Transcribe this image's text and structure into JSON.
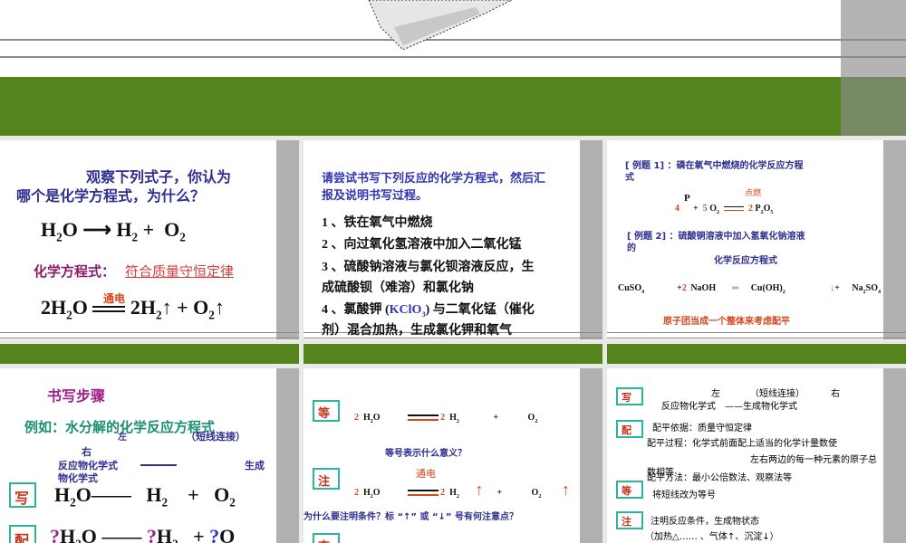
{
  "slide1": {
    "q1": "观察下列式子，你认为",
    "q2": "哪个是化学方程式，为什么？",
    "eq1": {
      "a": "H",
      "a2": "2",
      "a3": "O",
      "arrow": "⟶",
      "b": "H",
      "b2": "2",
      "plus": "+",
      "c": "O",
      "c2": "2"
    },
    "label": "化学方程式：",
    "law": "符合质量守恒定律",
    "cond": "通电",
    "eq2": {
      "a": "2H",
      "a2": "2",
      "a3": "O",
      "b": "2H",
      "b2": "2",
      "up": "↑",
      "plus": "+",
      "c": "O",
      "c2": "2"
    }
  },
  "slide2": {
    "title1": "请尝试书写下列反应的化学方程式，然后汇",
    "title2": "报及说明书写过程。",
    "items": [
      "1 、铁在氧气中燃烧",
      "2 、向过氧化氢溶液中加入二氧化锰",
      "3 、硫酸钠溶液与氯化钡溶液反应，生",
      "成硫酸钡（难溶）和氯化钠",
      "4 、氯酸钾 (",
      "KClO",
      "3",
      ") 与二氧化锰（催化",
      "剂）混合加热，生成氯化钾和氧气"
    ]
  },
  "slide3": {
    "ex1a": "[ 例题 1] ：磷在氧气中燃烧的化学反应方程",
    "ex1b": "式",
    "eqA": {
      "c1": "4",
      "p": "P",
      "plus": "+",
      "c2": "5",
      "o": "O",
      "o2": "2",
      "cond": "点燃",
      "c3": "2",
      "prod": "P",
      "p2": "2",
      "p3": "O",
      "p4": "5"
    },
    "ex2a": "[ 例题 2] ：硫酸铜溶液中加入氢氧化钠溶液",
    "ex2b": "的",
    "ex2c": "化学反应方程式",
    "eqB": {
      "a": "CuSO",
      "a2": "4",
      "plus": "+",
      "c": "2",
      "b": "NaOH",
      "eq": "═",
      "d": "Cu(OH)",
      "d2": "2",
      "down": "↓",
      "plus2": "+",
      "e": "Na",
      "e2": "2",
      "e3": "SO",
      "e4": "4"
    },
    "note": "原子团当成一个整体来考虑配平"
  },
  "slide4": {
    "title": "书写步骤",
    "example": "例如：水分解的化学反应方程式",
    "left": "左",
    "short": "（短线连接）",
    "right": "右",
    "reactant": "反应物化学式",
    "gen": "生成",
    "prod": "物化学式",
    "box1": "写",
    "eqW": {
      "a": "H",
      "a2": "2",
      "a3": "O",
      "dash": "—",
      "b": "H",
      "b2": "2",
      "plus": "+",
      "c": "O",
      "c2": "2"
    },
    "box2": "配",
    "eqP": {
      "q": "?",
      "a": "H",
      "a2": "2",
      "a3": "O",
      "dash": "—",
      "b": "H",
      "b2": "2",
      "plus": "+",
      "c": "O"
    }
  },
  "slide5": {
    "box1": "等",
    "eq1": {
      "c1": "2",
      "a": "H",
      "a2": "2",
      "a3": "O",
      "c2": "2",
      "b": "H",
      "b2": "2",
      "plus": "+",
      "c": "O",
      "c2b": "2"
    },
    "q1": "等号表示什么意义？",
    "box2": "注",
    "cond": "通电",
    "up": "↑",
    "q2": "为什么要注明条件？标 “↑” 或 “↓” 号有何注意点？",
    "box3": "查"
  },
  "slide6": {
    "box1": "写",
    "left": "左",
    "short": "（短线连接）",
    "right": "右",
    "line1": "反应物化学式　——生成物化学式",
    "box2": "配",
    "basis": "配平依据：质量守恒定律",
    "process1": "配平过程：化学式前面配上适当的化学计量数使",
    "process2": "左右两边的每一种元素的原子总",
    "process3": "数相等",
    "method": "配平方法：最小公倍数法、观察法等",
    "box3": "等",
    "eqNote": "将短线改为等号",
    "box4": "注",
    "cond": "注明反应条件，生成物状态",
    "cond2": "（加热△…… 、气体↑、沉淀↓）"
  }
}
